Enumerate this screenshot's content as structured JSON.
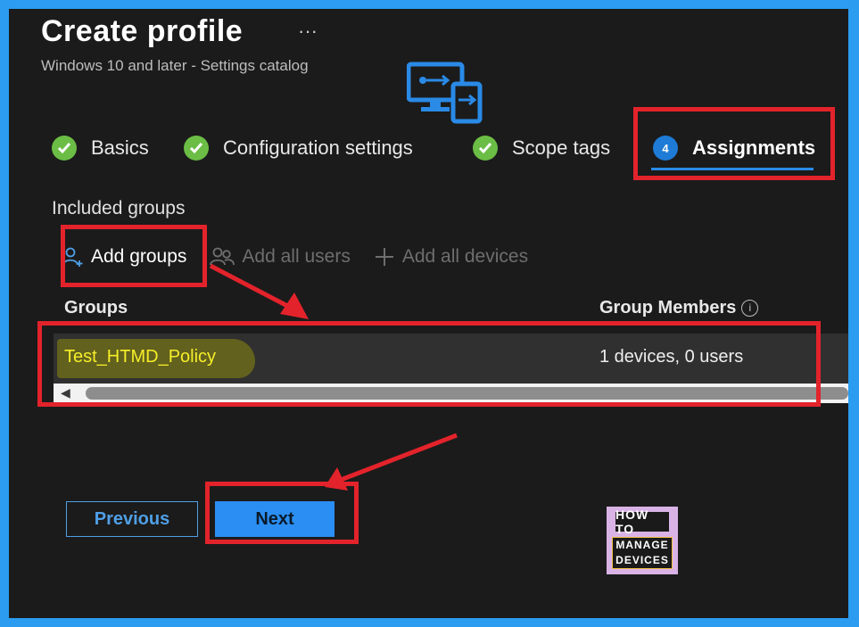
{
  "header": {
    "title": "Create profile",
    "more_label": "···",
    "subtitle": "Windows 10 and later - Settings catalog"
  },
  "steps": [
    {
      "label": "Basics",
      "state": "complete"
    },
    {
      "label": "Configuration settings",
      "state": "complete"
    },
    {
      "label": "Scope tags",
      "state": "complete"
    },
    {
      "label": "Assignments",
      "state": "current",
      "number": "4"
    }
  ],
  "assignments": {
    "section_label": "Included groups",
    "toolbar": {
      "add_groups": "Add groups",
      "add_all_users": "Add all users",
      "add_all_devices": "Add all devices"
    },
    "columns": {
      "groups": "Groups",
      "group_members": "Group Members"
    },
    "rows": [
      {
        "group": "Test_HTMD_Policy",
        "members": "1 devices, 0 users"
      }
    ]
  },
  "footer": {
    "previous_label": "Previous",
    "next_label": "Next"
  },
  "logo": {
    "line1": "HOW TO",
    "line2": "MANAGE",
    "line3": "DEVICES"
  },
  "colors": {
    "accent": "#2b8ef2",
    "success": "#6bbd45",
    "annotation_red": "#e3232b",
    "highlight_text": "#f5ee2a"
  },
  "icons": {
    "steps_complete": "check-circle-icon",
    "add_groups": "add-person-icon",
    "add_all_users": "people-icon",
    "add_all_devices": "plus-icon",
    "info": "info-icon",
    "header_graphic": "remote-device-icon"
  }
}
